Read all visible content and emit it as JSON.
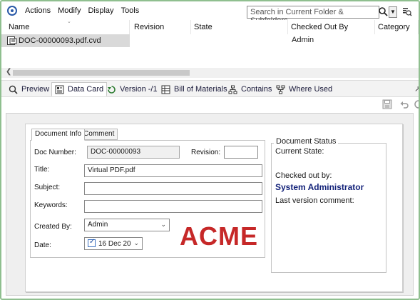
{
  "menu": {
    "items": [
      "Actions",
      "Modify",
      "Display",
      "Tools"
    ]
  },
  "search": {
    "placeholder": "Search in Current Folder & Subfolders"
  },
  "filelist": {
    "columns": [
      "Name",
      "Revision",
      "State",
      "Checked Out By",
      "Category"
    ],
    "rows": [
      {
        "name": "DOC-00000093.pdf.cvd",
        "revision": "",
        "state": "",
        "checked_out_by": "Admin",
        "category": ""
      }
    ]
  },
  "tabs": [
    {
      "label": "Preview",
      "icon": "preview-icon"
    },
    {
      "label": "Data Card",
      "icon": "data-card-icon"
    },
    {
      "label": "Version -/1",
      "icon": "version-icon"
    },
    {
      "label": "Bill of Materials",
      "icon": "bill-of-materials-icon"
    },
    {
      "label": "Contains",
      "icon": "contains-icon"
    },
    {
      "label": "Where Used",
      "icon": "where-used-icon"
    }
  ],
  "datacard": {
    "tabs": [
      "Document Info",
      "Comment"
    ],
    "labels": {
      "doc_number": "Doc Number:",
      "revision": "Revision:",
      "title": "Title:",
      "subject": "Subject:",
      "keywords": "Keywords:",
      "created_by": "Created By:",
      "date": "Date:"
    },
    "values": {
      "doc_number": "DOC-00000093",
      "revision": "",
      "title": "Virtual PDF.pdf",
      "subject": "",
      "keywords": "",
      "created_by": "Admin",
      "date": "16 Dec 20"
    },
    "logo_text": "ACME",
    "status": {
      "legend": "Document Status",
      "current_state_label": "Current State:",
      "checked_out_label": "Checked out by:",
      "checked_out_user": "System Administrator",
      "last_comment_label": "Last version comment:"
    }
  },
  "colors": {
    "frame_border": "#8fbf8f",
    "logo": "#c62828",
    "user_text": "#14237a",
    "selected_row": "#d9d9d9"
  }
}
